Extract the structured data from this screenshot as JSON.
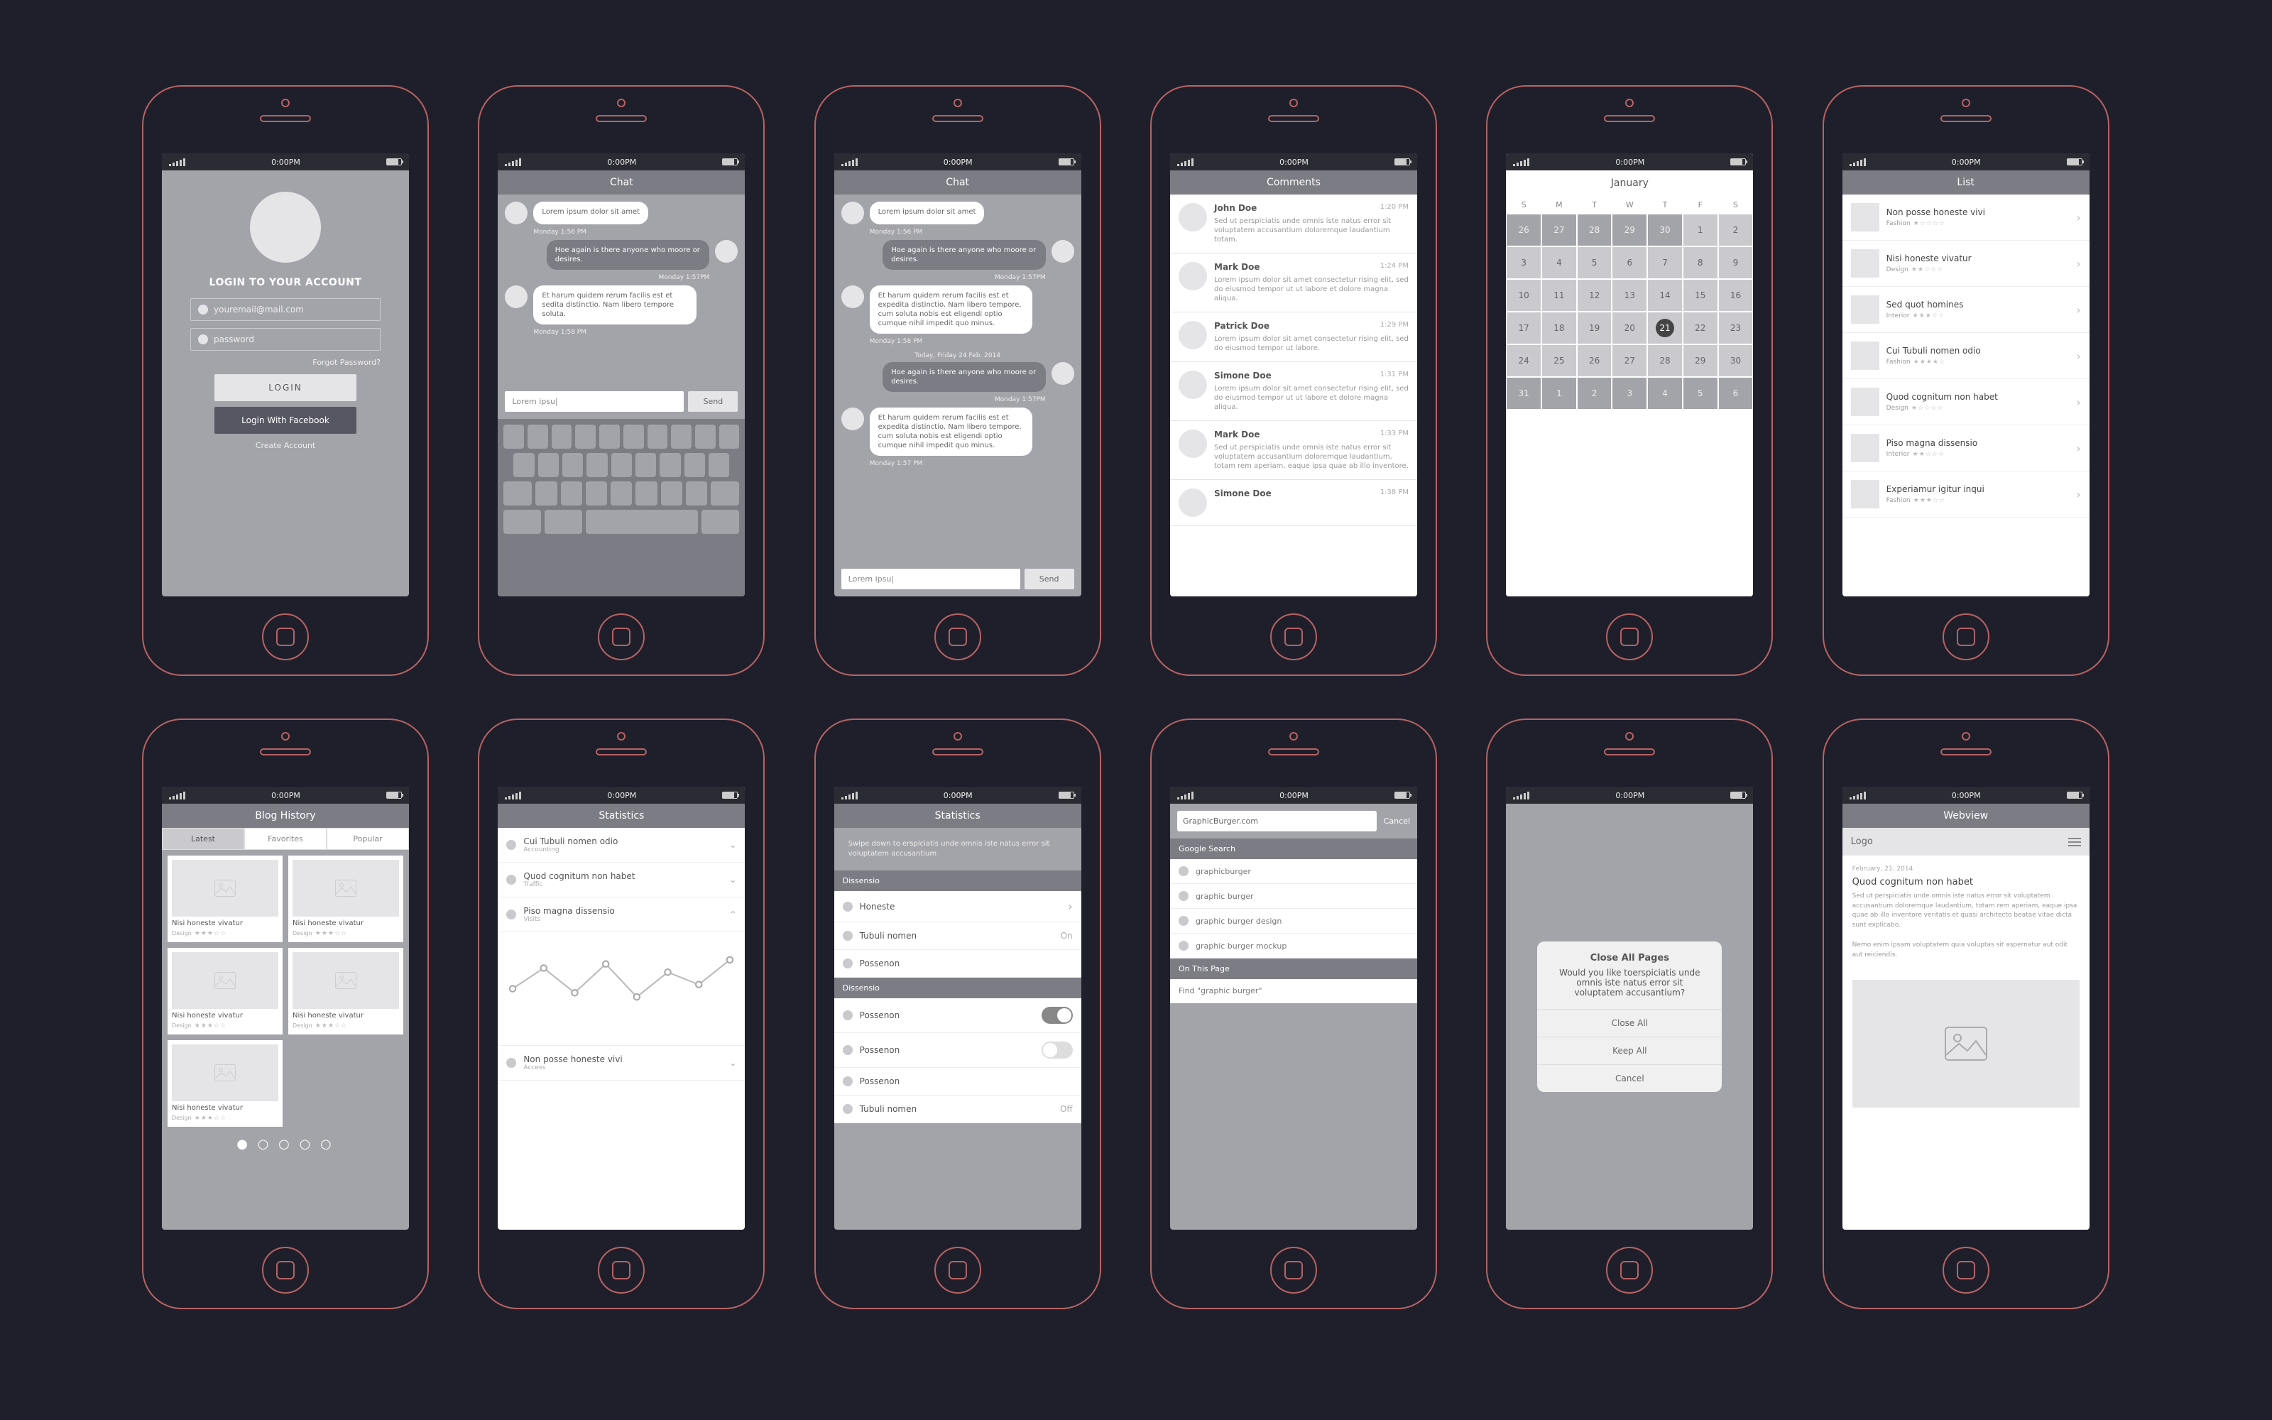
{
  "status": {
    "time": "0:00PM"
  },
  "login": {
    "heading": "LOGIN TO YOUR ACCOUNT",
    "email": "youremail@mail.com",
    "password": "password",
    "forgot": "Forgot Password?",
    "login_btn": "LOGIN",
    "fb_btn": "Login With Facebook",
    "create": "Create Account"
  },
  "chat": {
    "title": "Chat",
    "m1": "Lorem ipsum dolor sit amet",
    "t1": "Monday 1:56 PM",
    "m2": "Hoe again is there anyone who moore or desires.",
    "t2": "Monday 1:57PM",
    "m3": "Et harum quidem rerum facilis est et sedita distinctio. Nam libero tempore soluta.",
    "t3": "Monday 1:58 PM",
    "divider": "Today, Friday 24 Feb. 2014",
    "m4": "Hoe again is there anyone who moore or desires.",
    "t4": "Monday 1:57PM",
    "m5": "Et harum quidem rerum facilis est et expedita distinctio. Nam libero tempore, cum soluta nobis est eligendi optio cumque nihil impedit quo minus.",
    "t5": "Monday 1:57 PM",
    "placeholder": "Lorem ipsu|",
    "send": "Send"
  },
  "comments": {
    "title": "Comments",
    "items": [
      {
        "name": "John Doe",
        "time": "1:20 PM",
        "text": "Sed ut perspiciatis unde omnis iste natus error sit voluptatem accusantium doloremque laudantium totam."
      },
      {
        "name": "Mark Doe",
        "time": "1:24 PM",
        "text": "Lorem ipsum dolor sit amet consectetur rising elit, sed do eiusmod tempor ut ut labore et dolore magna aliqua."
      },
      {
        "name": "Patrick Doe",
        "time": "1:29 PM",
        "text": "Lorem ipsum dolor sit amet consectetur rising elit, sed do eiusmod tempor ut labore."
      },
      {
        "name": "Simone Doe",
        "time": "1:31 PM",
        "text": "Lorem ipsum dolor sit amet consectetur rising elit, sed do eiusmod tempor ut ut labore et dolore magna aliqua."
      },
      {
        "name": "Mark Doe",
        "time": "1:33 PM",
        "text": "Sed ut perspiciatis unde omnis iste natus error sit voluptatem accusantium doloremque laudantium, totam rem aperiam, eaque ipsa quae ab illo inventore."
      },
      {
        "name": "Simone Doe",
        "time": "1:38 PM",
        "text": ""
      }
    ]
  },
  "calendar": {
    "month": "January",
    "dow": [
      "S",
      "M",
      "T",
      "W",
      "T",
      "F",
      "S"
    ],
    "weeks": [
      [
        {
          "n": 26,
          "dim": true
        },
        {
          "n": 27,
          "dim": true
        },
        {
          "n": 28,
          "dim": true
        },
        {
          "n": 29,
          "dim": true
        },
        {
          "n": 30,
          "dim": true
        },
        {
          "n": 1
        },
        {
          "n": 2
        }
      ],
      [
        {
          "n": 3
        },
        {
          "n": 4
        },
        {
          "n": 5
        },
        {
          "n": 6
        },
        {
          "n": 7
        },
        {
          "n": 8
        },
        {
          "n": 9
        }
      ],
      [
        {
          "n": 10
        },
        {
          "n": 11
        },
        {
          "n": 12
        },
        {
          "n": 13
        },
        {
          "n": 14
        },
        {
          "n": 15
        },
        {
          "n": 16
        }
      ],
      [
        {
          "n": 17
        },
        {
          "n": 18
        },
        {
          "n": 19
        },
        {
          "n": 20
        },
        {
          "n": 21,
          "today": true
        },
        {
          "n": 22
        },
        {
          "n": 23
        }
      ],
      [
        {
          "n": 24
        },
        {
          "n": 25
        },
        {
          "n": 26
        },
        {
          "n": 27
        },
        {
          "n": 28
        },
        {
          "n": 29
        },
        {
          "n": 30
        }
      ],
      [
        {
          "n": 31,
          "dim": true
        },
        {
          "n": 1,
          "dim": true
        },
        {
          "n": 2,
          "dim": true
        },
        {
          "n": 3,
          "dim": true
        },
        {
          "n": 4,
          "dim": true
        },
        {
          "n": 5,
          "dim": true
        },
        {
          "n": 6,
          "dim": true
        }
      ]
    ]
  },
  "list": {
    "title": "List",
    "items": [
      {
        "name": "Non posse honeste vivi",
        "cat": "Fashion",
        "stars": "★☆☆☆☆"
      },
      {
        "name": "Nisi honeste vivatur",
        "cat": "Design",
        "stars": "★★☆☆☆"
      },
      {
        "name": "Sed quot homines",
        "cat": "Interior",
        "stars": "★★★☆☆"
      },
      {
        "name": "Cui Tubuli nomen odio",
        "cat": "Fashion",
        "stars": "★★★★☆"
      },
      {
        "name": "Quod cognitum non habet",
        "cat": "Design",
        "stars": "★☆☆☆☆"
      },
      {
        "name": "Piso magna dissensio",
        "cat": "Interior",
        "stars": "★★☆☆☆"
      },
      {
        "name": "Experiamur igitur inqui",
        "cat": "Fashion",
        "stars": "★★★☆☆"
      }
    ]
  },
  "blog": {
    "title": "Blog History",
    "tabs": [
      "Latest",
      "Favorites",
      "Popular"
    ],
    "card_name": "Nisi honeste vivatur",
    "card_cat": "Design",
    "card_stars": "★★★☆☆"
  },
  "stats": {
    "title": "Statistics",
    "rows": [
      {
        "name": "Cui Tubuli nomen odio",
        "sub": "Accounting",
        "open": false
      },
      {
        "name": "Quod cognitum non habet",
        "sub": "Traffic",
        "open": false
      },
      {
        "name": "Piso magna dissensio",
        "sub": "Visits",
        "open": true
      },
      {
        "name": "Non posse honeste vivi",
        "sub": "Access",
        "open": false
      }
    ]
  },
  "stats2": {
    "brief": "Swipe down to erspiciatis unde omnis iste natus error sit voluptatem accusantium",
    "s1": "Dissensio",
    "r1": "Honeste",
    "r2": "Tubuli nomen",
    "r2v": "On",
    "r3": "Possenon",
    "s2": "Dissensio",
    "r4": "Possenon",
    "r5": "Possenon",
    "r6": "Possenon",
    "r7": "Tubuli nomen",
    "r7v": "Off"
  },
  "search": {
    "value": "GraphicBurger.com",
    "cancel": "Cancel",
    "h1": "Google Search",
    "opts": [
      "graphicburger",
      "graphic burger",
      "graphic burger design",
      "graphic burger mockup"
    ],
    "h2": "On This Page",
    "find": "Find \"graphic burger\""
  },
  "modal": {
    "title": "Close All Pages",
    "msg": "Would you like toerspiciatis unde omnis iste natus error sit voluptatem accusantium?",
    "o1": "Close All",
    "o2": "Keep All",
    "o3": "Cancel"
  },
  "webview": {
    "title": "Webview",
    "logo": "Logo",
    "date": "February, 21, 2014",
    "heading": "Quod cognitum non habet",
    "p1": "Sed ut perspiciatis unde omnis iste natus error sit voluptatem accusantium doloremque laudantium, totam rem aperiam, eaque ipsa quae ab illo inventore veritatis et quasi architecto beatae vitae dicta sunt explicabo.",
    "p2": "Nemo enim ipsam voluptatem quia voluptas sit aspernatur aut odit aut reiciendis."
  },
  "chart_data": {
    "type": "line",
    "x": [
      0,
      1,
      2,
      3,
      4,
      5,
      6,
      7
    ],
    "values": [
      50,
      75,
      45,
      80,
      40,
      70,
      55,
      85
    ],
    "ylim": [
      0,
      100
    ]
  }
}
